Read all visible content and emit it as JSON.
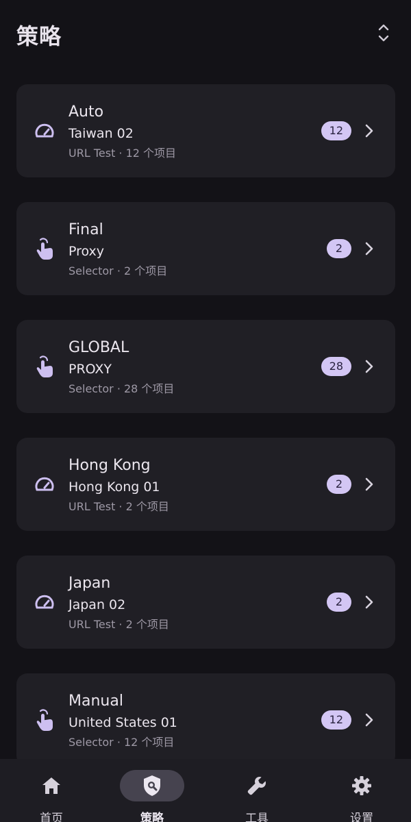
{
  "header": {
    "title": "策略"
  },
  "groups": [
    {
      "name": "Auto",
      "selected": "Taiwan 02",
      "meta": "URL Test · 12 个项目",
      "count": "12",
      "icon": "speedometer-icon"
    },
    {
      "name": "Final",
      "selected": "Proxy",
      "meta": "Selector · 2 个项目",
      "count": "2",
      "icon": "tap-hand-icon"
    },
    {
      "name": "GLOBAL",
      "selected": "PROXY",
      "meta": "Selector · 28 个项目",
      "count": "28",
      "icon": "tap-hand-icon"
    },
    {
      "name": "Hong Kong",
      "selected": "Hong Kong 01",
      "meta": "URL Test · 2 个项目",
      "count": "2",
      "icon": "speedometer-icon"
    },
    {
      "name": "Japan",
      "selected": "Japan 02",
      "meta": "URL Test · 2 个项目",
      "count": "2",
      "icon": "speedometer-icon"
    },
    {
      "name": "Manual",
      "selected": "United States 01",
      "meta": "Selector · 12 个项目",
      "count": "12",
      "icon": "tap-hand-icon"
    }
  ],
  "nav": [
    {
      "label": "首页",
      "icon": "home-icon"
    },
    {
      "label": "策略",
      "icon": "shield-search-icon",
      "active": true
    },
    {
      "label": "工具",
      "icon": "wrench-icon"
    },
    {
      "label": "设置",
      "icon": "gear-icon"
    }
  ],
  "colors": {
    "background": "#131217",
    "card": "#201f25",
    "accent": "#d3c6f4",
    "icon": "#cdbff0",
    "nav_bar": "#1e1d23",
    "nav_active_pill": "#46434f"
  }
}
